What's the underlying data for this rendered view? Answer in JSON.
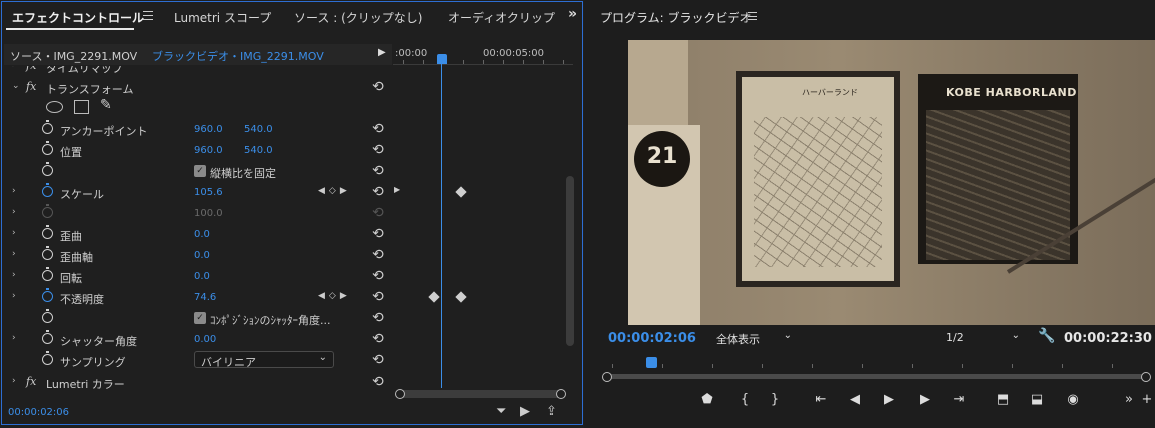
{
  "effect_controls": {
    "tabs": [
      {
        "label": "エフェクトコントロール"
      },
      {
        "label": "Lumetri スコープ"
      },
      {
        "label": "ソース : (クリップなし)"
      },
      {
        "label": "オーディオクリップ"
      }
    ],
    "source_label": "ソース・IMG_2291.MOV",
    "clip_label": "ブラックビデオ・IMG_2291.MOV",
    "ruler": {
      "start": ":00:00",
      "mid": "00:00:05:00"
    },
    "partial_top_label": "タイムリマップ",
    "transform": {
      "label": "トランスフォーム",
      "anchor": {
        "label": "アンカーポイント",
        "x": "960.0",
        "y": "540.0"
      },
      "position": {
        "label": "位置",
        "x": "960.0",
        "y": "540.0"
      },
      "uniform_scale": {
        "label": "縦横比を固定",
        "checked": true
      },
      "scale": {
        "label": "スケール",
        "value": "105.6"
      },
      "scale_width": {
        "value": "100.0"
      },
      "skew": {
        "label": "歪曲",
        "value": "0.0"
      },
      "skew_axis": {
        "label": "歪曲軸",
        "value": "0.0"
      },
      "rotation": {
        "label": "回転",
        "value": "0.0"
      },
      "opacity": {
        "label": "不透明度",
        "value": "74.6"
      },
      "shutter_comp": {
        "label": "ｺﾝﾎﾟｼﾞｼｮﾝのｼｬｯﾀｰ角度...",
        "checked": true
      },
      "shutter_angle": {
        "label": "シャッター角度",
        "value": "0.00"
      },
      "sampling": {
        "label": "サンプリング",
        "value": "バイリニア"
      }
    },
    "lumetri": {
      "label": "Lumetri カラー"
    },
    "timecode": "00:00:02:06"
  },
  "program_monitor": {
    "title": "プログラム: ブラックビデオ",
    "timecode": "00:00:02:06",
    "fit": "全体表示",
    "resolution": "1/2",
    "duration": "00:00:22:30",
    "video_text": {
      "station": "21",
      "kobe": "KOBE HARBORLAND",
      "map_title": "ハーバーランド"
    }
  },
  "colors": {
    "accent": "#3b8ee8",
    "panel_border": "#2d6ed3",
    "bg": "#1d1d1d"
  }
}
